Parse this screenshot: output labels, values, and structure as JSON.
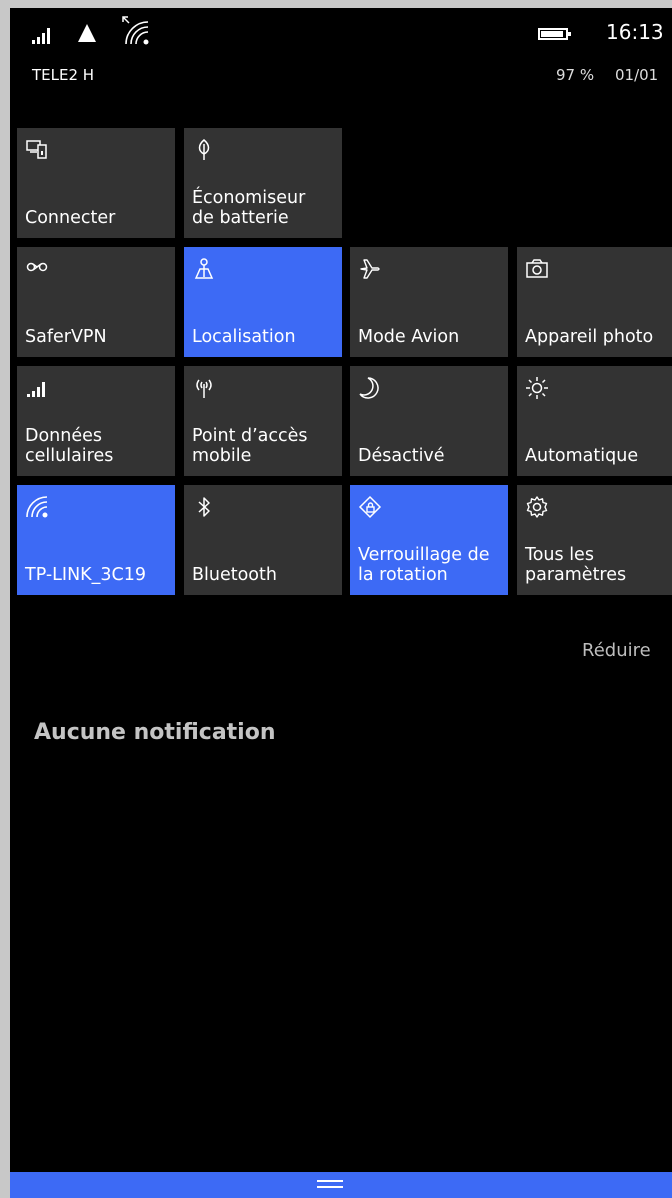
{
  "status": {
    "carrier": "TELE2 H",
    "time": "16:13",
    "battery_percent": "97 %",
    "date": "01/01"
  },
  "tiles": [
    {
      "label": "Connecter",
      "icon": "connect-icon",
      "active": false
    },
    {
      "label": "Économiseur\nde batterie",
      "icon": "battery-saver-icon",
      "active": false
    },
    {
      "label": "SaferVPN",
      "icon": "vpn-icon",
      "active": false
    },
    {
      "label": "Localisation",
      "icon": "location-icon",
      "active": true
    },
    {
      "label": "Mode Avion",
      "icon": "airplane-icon",
      "active": false
    },
    {
      "label": "Appareil photo",
      "icon": "camera-icon",
      "active": false
    },
    {
      "label": "Données\ncellulaires",
      "icon": "cellular-icon",
      "active": false
    },
    {
      "label": "Point d’accès\nmobile",
      "icon": "hotspot-icon",
      "active": false
    },
    {
      "label": "Désactivé",
      "icon": "moon-icon",
      "active": false
    },
    {
      "label": "Automatique",
      "icon": "brightness-icon",
      "active": false
    },
    {
      "label": "TP-LINK_3C19",
      "icon": "wifi-icon",
      "active": true
    },
    {
      "label": "Bluetooth",
      "icon": "bluetooth-icon",
      "active": false
    },
    {
      "label": "Verrouillage de\nla rotation",
      "icon": "rotation-lock-icon",
      "active": true
    },
    {
      "label": "Tous les\nparamètres",
      "icon": "gear-icon",
      "active": false
    }
  ],
  "collapse_label": "Réduire",
  "notifications_empty": "Aucune notification",
  "colors": {
    "accent": "#3d6af5",
    "tile": "#333333",
    "background": "#000000"
  }
}
